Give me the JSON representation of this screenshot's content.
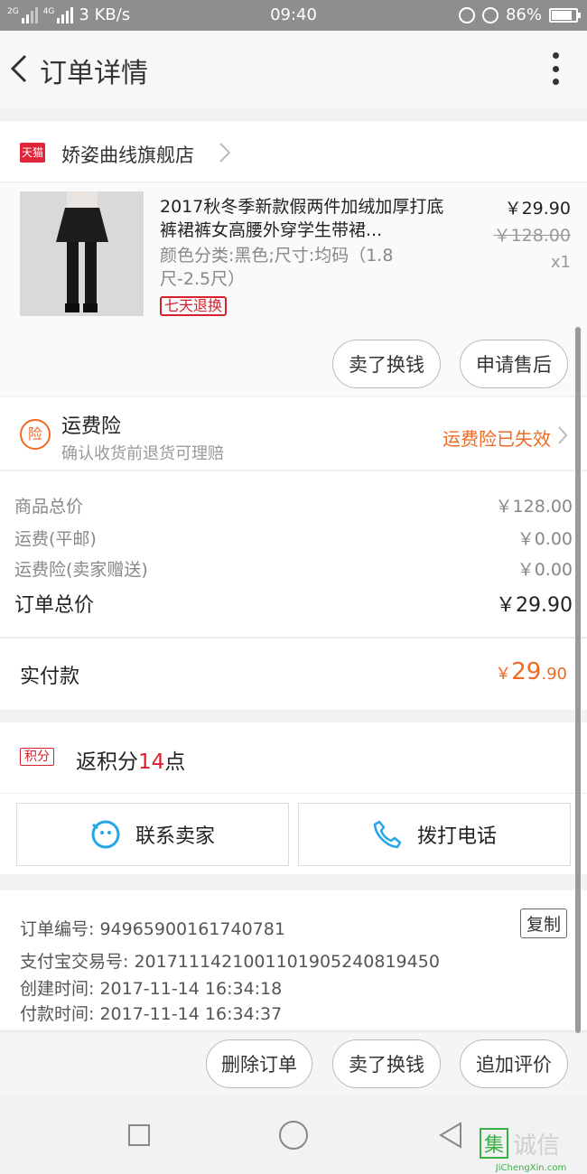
{
  "status_bar": {
    "network_1": "2G",
    "network_2": "4G",
    "speed": "3 KB/s",
    "time": "09:40",
    "battery_pct": "86%",
    "battery_level": 0.86
  },
  "header": {
    "title": "订单详情"
  },
  "shop": {
    "badge": "天猫",
    "name": "娇姿曲线旗舰店"
  },
  "product": {
    "title": "2017秋冬季新款假两件加绒加厚打底裤裙裤女高腰外穿学生带裙...",
    "spec": "颜色分类:黑色;尺寸:均码（1.8尺-2.5尺）",
    "return_badge": "七天退换",
    "price": "￥29.90",
    "original_price": "￥128.00",
    "quantity": "x1",
    "sell_label": "卖了换钱",
    "after_sale_label": "申请售后"
  },
  "insurance": {
    "icon_text": "险",
    "title": "运费险",
    "subtitle": "确认收货前退货可理赔",
    "status": "运费险已失效"
  },
  "summary": {
    "rows": [
      {
        "label": "商品总价",
        "value": "￥128.00"
      },
      {
        "label": "运费(平邮)",
        "value": "￥0.00"
      },
      {
        "label": "运费险(卖家赠送)",
        "value": "￥0.00"
      }
    ],
    "total_label": "订单总价",
    "total_value": "￥29.90"
  },
  "paid": {
    "label": "实付款",
    "symbol": "￥",
    "integer": "29",
    "decimal": ".90"
  },
  "points": {
    "tag": "积分",
    "prefix": "返积分",
    "count": "14",
    "suffix": "点"
  },
  "contact": {
    "seller_label": "联系卖家",
    "phone_label": "拨打电话"
  },
  "order_info": {
    "order_no": "订单编号: 94965900161740781",
    "alipay_no": "支付宝交易号: 2017111421001101905240819450",
    "created": "创建时间: 2017-11-14 16:34:18",
    "paid_time": "付款时间: 2017-11-14 16:34:37",
    "copy_label": "复制"
  },
  "bottom_actions": {
    "delete_label": "删除订单",
    "sell_label": "卖了换钱",
    "review_label": "追加评价"
  },
  "watermark": {
    "logo_chars": "集诚信",
    "url": "JiChengXin.com"
  },
  "colors": {
    "accent_orange": "#ef6a22",
    "tmall_red": "#e0243a",
    "badge_red": "#d8212f"
  }
}
